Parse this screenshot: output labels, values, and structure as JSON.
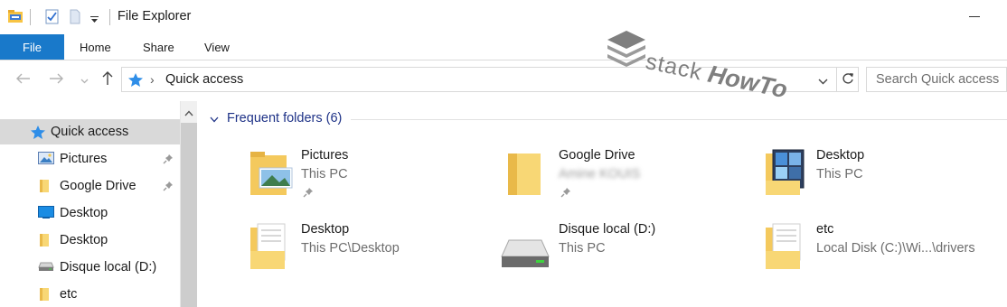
{
  "window": {
    "title": "File Explorer"
  },
  "ribbon": {
    "tabs": [
      {
        "label": "File",
        "active": true
      },
      {
        "label": "Home"
      },
      {
        "label": "Share"
      },
      {
        "label": "View"
      }
    ]
  },
  "address": {
    "path": "Quick access",
    "path_icon": "star-icon"
  },
  "search": {
    "placeholder": "Search Quick access"
  },
  "watermark": {
    "part1": "stack",
    "part2": "HowTo"
  },
  "sidebar": {
    "items": [
      {
        "label": "Quick access",
        "icon": "star-icon",
        "selected": true,
        "pinned": false
      },
      {
        "label": "Pictures",
        "icon": "pictures-icon",
        "pinned": true
      },
      {
        "label": "Google Drive",
        "icon": "folder-icon",
        "pinned": true
      },
      {
        "label": "Desktop",
        "icon": "desktop-icon",
        "pinned": false
      },
      {
        "label": "Desktop",
        "icon": "folder-icon",
        "pinned": false
      },
      {
        "label": "Disque local (D:)",
        "icon": "drive-icon",
        "pinned": false
      },
      {
        "label": "etc",
        "icon": "folder-icon",
        "pinned": false
      }
    ]
  },
  "content": {
    "group_title": "Frequent folders (6)",
    "folders": [
      {
        "name": "Pictures",
        "location": "This PC",
        "pinned": true,
        "icon": "pictures-folder-icon"
      },
      {
        "name": "Google Drive",
        "location": "Amine KOUIS",
        "blurred": true,
        "pinned": true,
        "icon": "folder-icon"
      },
      {
        "name": "Desktop",
        "location": "This PC",
        "pinned": false,
        "icon": "desktop-folder-icon"
      },
      {
        "name": "Desktop",
        "location": "This PC\\Desktop",
        "pinned": false,
        "icon": "documents-folder-icon"
      },
      {
        "name": "Disque local (D:)",
        "location": "This PC",
        "pinned": false,
        "icon": "hard-drive-icon"
      },
      {
        "name": "etc",
        "location": "Local Disk (C:)\\Wi...\\drivers",
        "pinned": false,
        "icon": "documents-folder-icon"
      }
    ]
  },
  "colors": {
    "accent": "#1979ca",
    "group_title": "#1e3287",
    "selection": "#d9d9d9",
    "folder_yellow": "#f8d775"
  }
}
